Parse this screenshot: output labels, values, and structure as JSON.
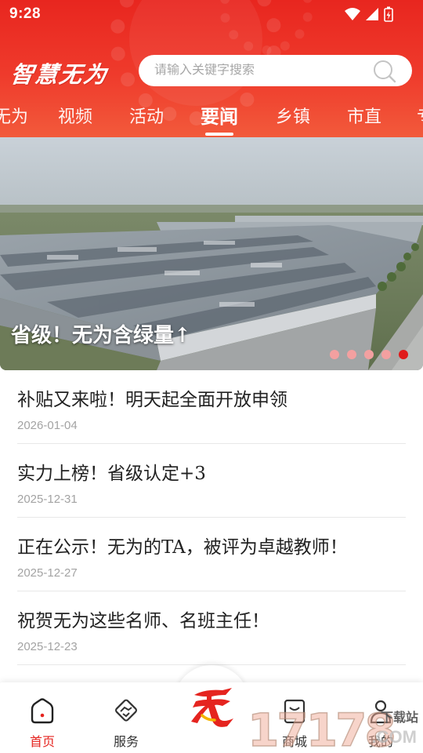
{
  "status_bar": {
    "time": "9:28"
  },
  "header": {
    "logo_text": "智慧无为",
    "search_placeholder": "请输入关键字搜索",
    "tabs": [
      {
        "label": "无为",
        "active": false
      },
      {
        "label": "视频",
        "active": false
      },
      {
        "label": "活动",
        "active": false
      },
      {
        "label": "要闻",
        "active": true
      },
      {
        "label": "乡镇",
        "active": false
      },
      {
        "label": "市直",
        "active": false
      },
      {
        "label": "专",
        "active": false
      }
    ]
  },
  "banner": {
    "caption": "省级！无为含绿量↑",
    "page_count": 5,
    "active_page": 5
  },
  "news": [
    {
      "title": "补贴又来啦！明天起全面开放申领",
      "date": "2026-01-04"
    },
    {
      "title": "实力上榜！省级认定+3",
      "date": "2025-12-31"
    },
    {
      "title": "正在公示！无为的TA，被评为卓越教师！",
      "date": "2025-12-27"
    },
    {
      "title": "祝贺无为这些名师、名班主任！",
      "date": "2025-12-23"
    }
  ],
  "bottom_nav": [
    {
      "label": "首页",
      "icon": "home-icon",
      "active": true
    },
    {
      "label": "服务",
      "icon": "handshake-icon",
      "active": false
    },
    {
      "label": "",
      "icon": "center-logo-icon",
      "active": false
    },
    {
      "label": "商城",
      "icon": "shop-icon",
      "active": false
    },
    {
      "label": "我的",
      "icon": "user-icon",
      "active": false
    }
  ],
  "watermark": {
    "number": "17178",
    "site": "下载站",
    "suffix": ".COM"
  },
  "colors": {
    "brand_red": "#e5241f",
    "header_red": "#ef3b2c"
  }
}
